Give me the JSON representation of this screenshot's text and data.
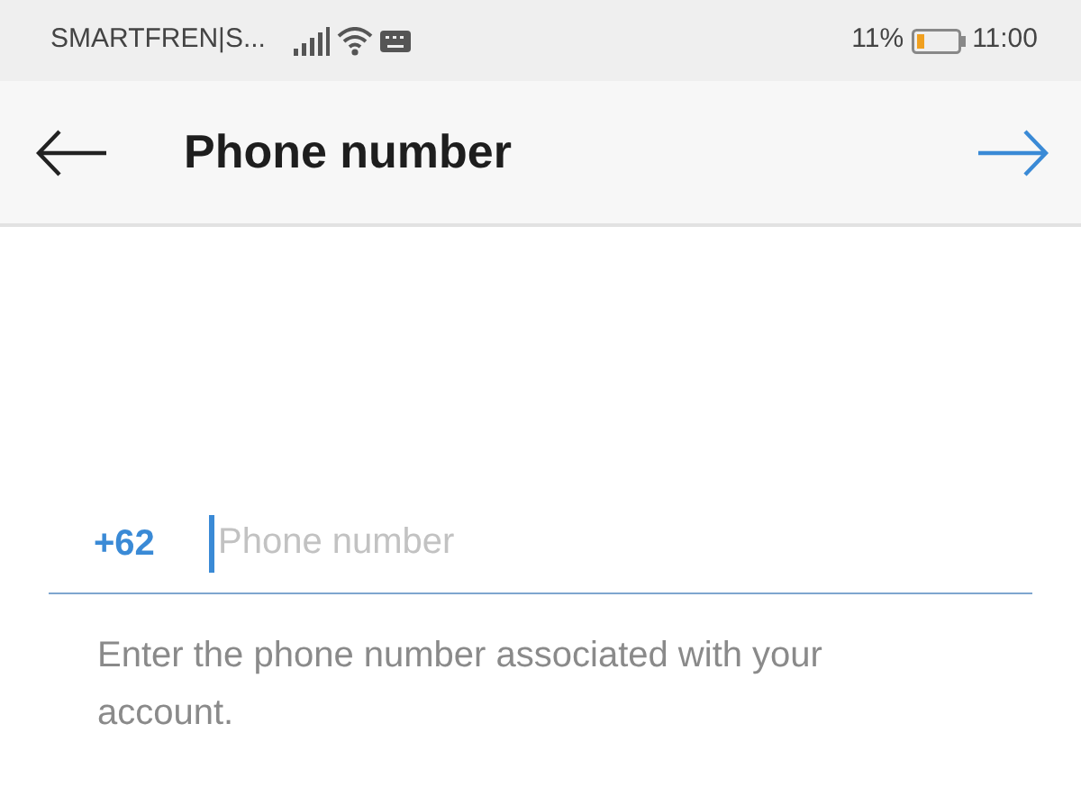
{
  "status_bar": {
    "carrier": "SMARTFREN|S...",
    "battery_percent": "11%",
    "time": "11:00"
  },
  "app_bar": {
    "title": "Phone number"
  },
  "phone_field": {
    "country_code": "+62",
    "placeholder": "Phone number"
  },
  "helper_text": "Enter the phone number associated with your account."
}
